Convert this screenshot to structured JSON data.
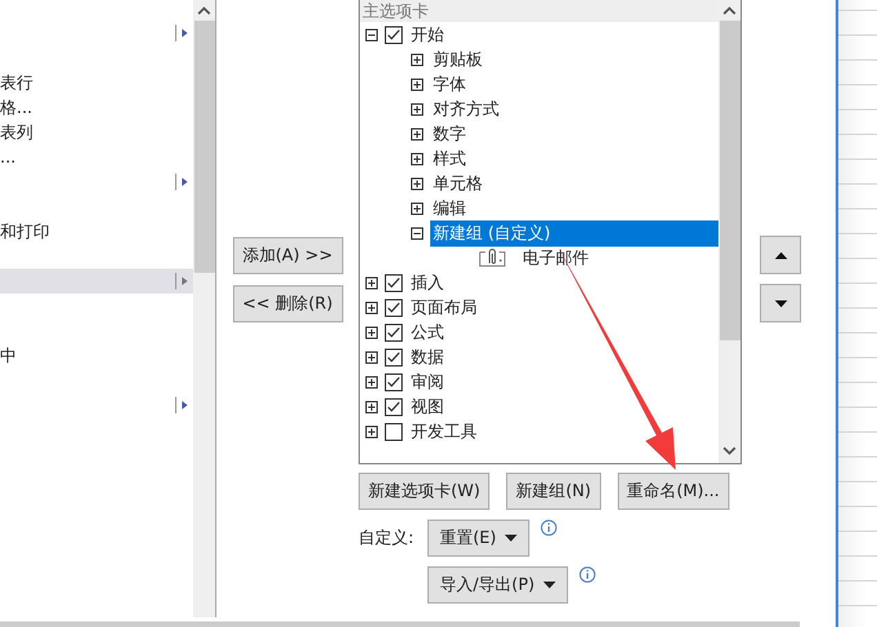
{
  "left_list": {
    "items": [
      {
        "kind": "item",
        "has_submenu": true,
        "selected": false
      },
      {
        "kind": "spacer"
      },
      {
        "kind": "item",
        "text": "表行",
        "selected": false
      },
      {
        "kind": "item",
        "text": "格...",
        "selected": false
      },
      {
        "kind": "item",
        "text": "表列",
        "selected": false
      },
      {
        "kind": "item",
        "text": "...",
        "selected": false
      },
      {
        "kind": "item",
        "has_submenu": true,
        "selected": false
      },
      {
        "kind": "spacer"
      },
      {
        "kind": "item",
        "text": "和打印",
        "selected": false
      },
      {
        "kind": "spacer"
      },
      {
        "kind": "item",
        "has_submenu": true,
        "selected": true
      },
      {
        "kind": "spacer"
      },
      {
        "kind": "spacer"
      },
      {
        "kind": "item",
        "text": "中",
        "selected": false
      },
      {
        "kind": "spacer"
      },
      {
        "kind": "item",
        "has_submenu": true,
        "selected": false
      }
    ]
  },
  "transfer_buttons": [
    "添加(A) >>",
    "<< 删除(R)"
  ],
  "tree": {
    "header": "主选项卡",
    "items": [
      {
        "kind": "tab",
        "label": "开始",
        "checked": true,
        "expanded": true,
        "selected": false,
        "children": [
          {
            "kind": "group",
            "label": "剪贴板",
            "expanded": false,
            "selected": false
          },
          {
            "kind": "group",
            "label": "字体",
            "expanded": false,
            "selected": false
          },
          {
            "kind": "group",
            "label": "对齐方式",
            "expanded": false,
            "selected": false
          },
          {
            "kind": "group",
            "label": "数字",
            "expanded": false,
            "selected": false
          },
          {
            "kind": "group",
            "label": "样式",
            "expanded": false,
            "selected": false
          },
          {
            "kind": "group",
            "label": "单元格",
            "expanded": false,
            "selected": false
          },
          {
            "kind": "group",
            "label": "编辑",
            "expanded": false,
            "selected": false
          },
          {
            "kind": "group",
            "label": "新建组 (自定义)",
            "expanded": true,
            "selected": true,
            "children": [
              {
                "kind": "command",
                "label": "电子邮件",
                "selected": false
              }
            ]
          }
        ]
      },
      {
        "kind": "tab",
        "label": "插入",
        "checked": true,
        "expanded": false,
        "selected": false
      },
      {
        "kind": "tab",
        "label": "页面布局",
        "checked": true,
        "expanded": false,
        "selected": false
      },
      {
        "kind": "tab",
        "label": "公式",
        "checked": true,
        "expanded": false,
        "selected": false
      },
      {
        "kind": "tab",
        "label": "数据",
        "checked": true,
        "expanded": false,
        "selected": false
      },
      {
        "kind": "tab",
        "label": "审阅",
        "checked": true,
        "expanded": false,
        "selected": false
      },
      {
        "kind": "tab",
        "label": "视图",
        "checked": true,
        "expanded": false,
        "selected": false
      },
      {
        "kind": "tab",
        "label": "开发工具",
        "checked": false,
        "expanded": false,
        "selected": false
      }
    ]
  },
  "tree_buttons": [
    "新建选项卡(W)",
    "新建组(N)",
    "重命名(M)..."
  ],
  "customize": {
    "label": "自定义:",
    "reset_button": "重置(E)",
    "import_export_button": "导入/导出(P)"
  }
}
